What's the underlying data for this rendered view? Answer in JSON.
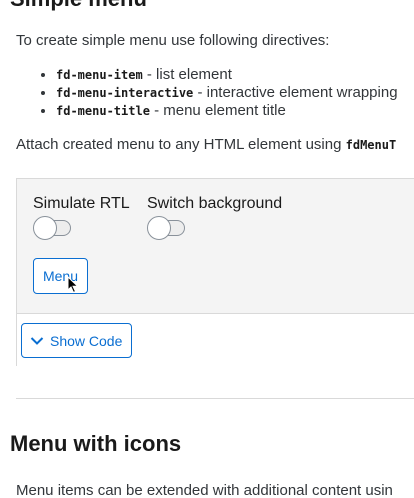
{
  "section1": {
    "heading": "Simple menu",
    "intro": "To create simple menu use following directives:",
    "directives": [
      {
        "code": "fd-menu-item",
        "desc": " - list element"
      },
      {
        "code": "fd-menu-interactive",
        "desc": " - interactive element wrapping"
      },
      {
        "code": "fd-menu-title",
        "desc": " - menu element title"
      }
    ],
    "attach_text": "Attach created menu to any HTML element using ",
    "attach_code": "fdMenuT"
  },
  "example": {
    "switch_rtl_label": "Simulate RTL",
    "switch_rtl_on": false,
    "switch_bg_label": "Switch background",
    "switch_bg_on": false,
    "menu_button_label": "Menu",
    "show_code_label": "Show Code"
  },
  "section2": {
    "heading": "Menu with icons",
    "desc": "Menu items can be extended with additional content usin"
  },
  "colors": {
    "accent": "#0a6ed1",
    "text": "#32363a",
    "panel_bg": "#f4f4f4",
    "border": "#d9d9d9"
  }
}
